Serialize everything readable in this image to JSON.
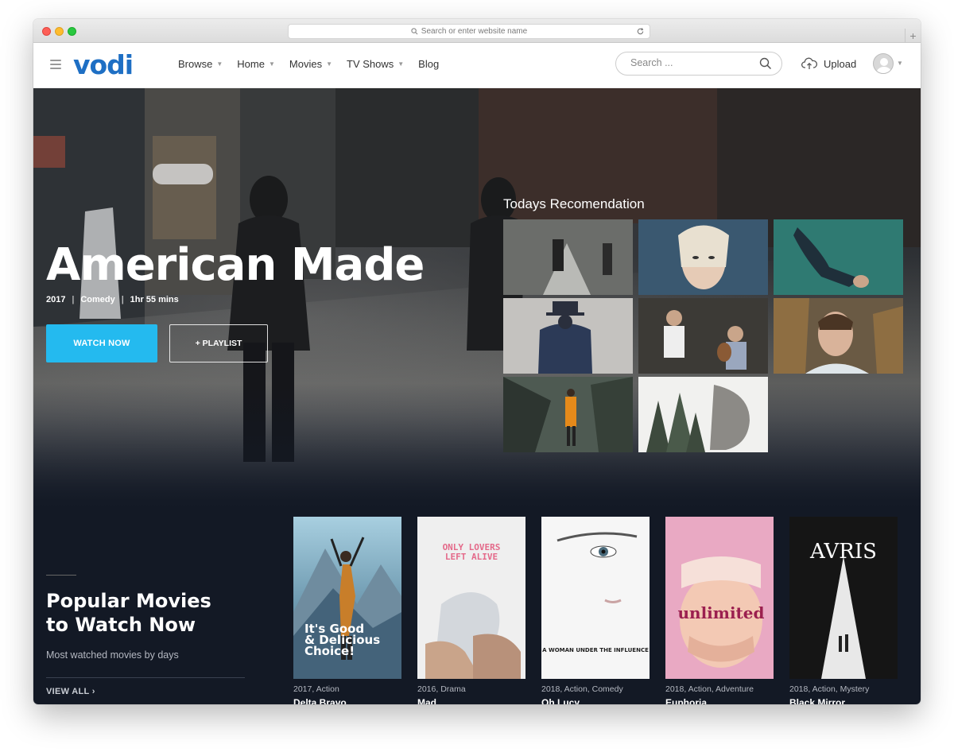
{
  "browser": {
    "url_placeholder": "Search or enter website name",
    "new_tab": "+"
  },
  "header": {
    "logo": "vodi",
    "nav": [
      {
        "label": "Browse",
        "dropdown": true
      },
      {
        "label": "Home",
        "dropdown": true
      },
      {
        "label": "Movies",
        "dropdown": true
      },
      {
        "label": "TV Shows",
        "dropdown": true
      },
      {
        "label": "Blog",
        "dropdown": false
      }
    ],
    "search_placeholder": "Search ...",
    "upload_label": "Upload"
  },
  "hero": {
    "title": "American Made",
    "year": "2017",
    "genre": "Comedy",
    "duration": "1hr 55 mins",
    "watch_label": "WATCH NOW",
    "playlist_label": "+ PLAYLIST",
    "recommendation_title": "Todays Recomendation"
  },
  "popular": {
    "title": "Popular Movies to Watch Now",
    "subtitle": "Most watched movies by days",
    "view_all": "VIEW ALL",
    "movies": [
      {
        "meta": "2017, Action",
        "title": "Delta Bravo",
        "poster_text": "It's Good & Delicious Choice!"
      },
      {
        "meta": "2016, Drama",
        "title": "Mad",
        "poster_text": "ONLY LOVERS LEFT ALIVE"
      },
      {
        "meta": "2018, Action, Comedy",
        "title": "Oh Lucy",
        "poster_text": "A WOMAN UNDER THE INFLUENCE"
      },
      {
        "meta": "2018, Action, Adventure",
        "title": "Euphoria",
        "poster_text": "unlimited"
      },
      {
        "meta": "2018, Action, Mystery",
        "title": "Black Mirror",
        "poster_text": "AVRIS"
      }
    ]
  },
  "colors": {
    "brand": "#1e6fc4",
    "accent": "#24baef",
    "section_bg": "#131925"
  }
}
